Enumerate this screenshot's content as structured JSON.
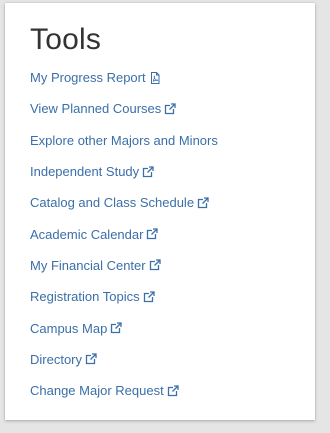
{
  "card": {
    "title": "Tools"
  },
  "links": [
    {
      "label": "My Progress Report",
      "icon": "pdf-icon"
    },
    {
      "label": "View Planned Courses",
      "icon": "external-link-icon"
    },
    {
      "label": "Explore other Majors and Minors",
      "icon": ""
    },
    {
      "label": "Independent Study",
      "icon": "external-link-icon"
    },
    {
      "label": "Catalog and Class Schedule",
      "icon": "external-link-icon"
    },
    {
      "label": "Academic Calendar",
      "icon": "external-link-icon"
    },
    {
      "label": "My Financial Center",
      "icon": "external-link-icon"
    },
    {
      "label": "Registration Topics",
      "icon": "external-link-icon"
    },
    {
      "label": "Campus Map",
      "icon": "external-link-icon"
    },
    {
      "label": "Directory",
      "icon": "external-link-icon"
    },
    {
      "label": "Change Major Request",
      "icon": "external-link-icon"
    }
  ],
  "colors": {
    "link": "#3a6fa8",
    "title": "#333333",
    "background": "#e5e5e5",
    "card": "#ffffff"
  }
}
